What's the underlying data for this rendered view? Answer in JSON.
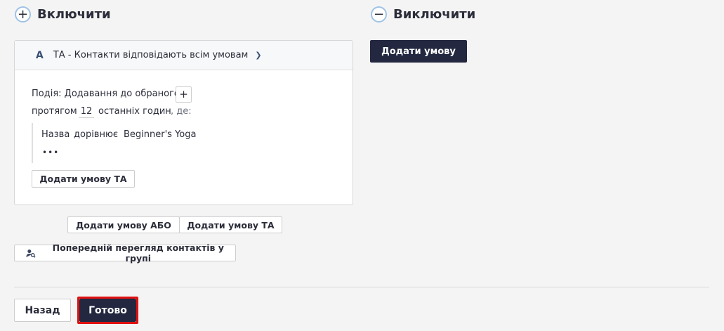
{
  "include": {
    "title": "Включити"
  },
  "exclude": {
    "title": "Виключити",
    "add_condition_label": "Додати умову"
  },
  "card": {
    "letter": "A",
    "header": "ТА - Контакти відповідають всім умовам",
    "event_label": "Подія: Додавання до обраного",
    "during_label": "протягом",
    "hours_value": "12",
    "hours_label": "останніх годин",
    "where_label": ", де:",
    "cond_field": "Назва",
    "cond_op": "дорівнює",
    "cond_value": "Beginner's Yoga",
    "more": "•••",
    "add_and_label": "Додати умову ТА"
  },
  "actions": {
    "add_or_label": "Додати умову АБО",
    "add_and_label": "Додати умову ТА",
    "preview_label": "Попередній перегляд контактів у групі"
  },
  "footer": {
    "back_label": "Назад",
    "done_label": "Готово"
  },
  "colors": {
    "dark_button": "#232840",
    "highlight": "#e01010",
    "icon_ring": "#9fc3e6"
  }
}
